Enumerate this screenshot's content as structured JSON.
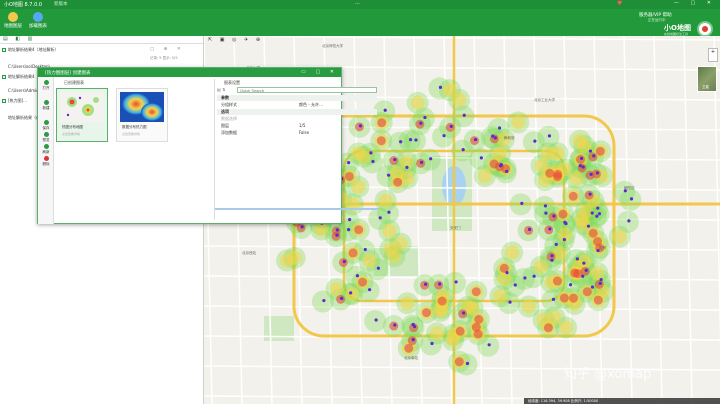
{
  "window": {
    "title": "小O地图 8.7.0.0",
    "badge": "新版本",
    "more": "...",
    "controls": "— ▢ ✕"
  },
  "ribbon": {
    "buttons": [
      {
        "label": "地图图层",
        "icon": "map-layers-icon",
        "color": "#f2c94c"
      },
      {
        "label": "加载图表",
        "icon": "chart-load-icon",
        "color": "#56a8f5"
      }
    ],
    "user": "服务器/VIP  帮助",
    "user_sub": "正在运行中",
    "help": "",
    "brand": "小O地图",
    "brand_sub": "在线地图标注工具"
  },
  "left_panel": {
    "toolbar": "▤ ◧ ▥",
    "layers": [
      {
        "label": "地址解析结果4（地址解析）",
        "sub": "",
        "tools": "▢ ⊕ ✕"
      },
      {
        "label": "C:\\Users\\xo\\Desktop\\",
        "sub": "记录: 5 显示: 5/5",
        "tools": ""
      },
      {
        "label": "地址解析结果4（地址解析）",
        "sub": "",
        "tools": ""
      },
      {
        "label": "C:\\Users\\Admin\\Desktop\\",
        "sub": "",
        "tools": ""
      },
      {
        "label": "[热力图]...",
        "sub": "",
        "tools": ""
      },
      {
        "label": "地址解析结果（在线地图...）",
        "sub": "",
        "tools": ""
      }
    ]
  },
  "dialog": {
    "title": "[热力图图层] 创建图表",
    "controls": "▭ ▢ ✕",
    "side_buttons": [
      {
        "label": "打开",
        "color": "#2e9a45"
      },
      {
        "label": "新建",
        "color": "#2e9a45"
      },
      {
        "label": "保存",
        "color": "#2e9a45"
      },
      {
        "label": "预览",
        "color": "#2e9a45"
      },
      {
        "label": "刷新",
        "color": "#2e9a45"
      },
      {
        "label": "删除",
        "color": "#d33"
      }
    ],
    "templates_label": "已创建图表",
    "templates": [
      {
        "label": "热图分布地图",
        "sub": "点击查看详情",
        "selected": true
      },
      {
        "label": "数据分布热力图",
        "sub": "点击查看详情",
        "selected": false
      }
    ],
    "props": {
      "title": "图表设置",
      "toolbar": "▤ ⇅",
      "search_placeholder": "Quick Search",
      "rows": [
        {
          "key": "参数",
          "value": "",
          "category": true
        },
        {
          "key": "分组样式",
          "value": "颜色 - 允许…",
          "category": false
        },
        {
          "key": "选项",
          "value": "",
          "category": true
        },
        {
          "key": "数据选择",
          "value": "",
          "category": false,
          "muted": true
        },
        {
          "key": "图层",
          "value": "1/5",
          "category": false
        },
        {
          "key": "添加数据",
          "value": "False",
          "category": false
        }
      ]
    }
  },
  "map": {
    "toolbar": "⇱ ▣ ◎ ✈ ⊕",
    "zoom": "+",
    "satellite_label": "卫星",
    "watermark": "知乎 @xomap",
    "status": "经纬度: 116.394, 39.908  比例尺: 1:50000",
    "labels": [
      "北京师范大学",
      "北京大学",
      "北京工业大学",
      "天安门",
      "朝阳区",
      "中关村",
      "雍和宫",
      "国贸",
      "北京西站",
      "北京南站"
    ],
    "colors": {
      "road_major": "#f2c84b",
      "road_minor": "#ffffff",
      "park": "#cfe8c2",
      "water": "#a8d3f0",
      "heat_low": "#7ed957",
      "heat_mid": "#f5d547",
      "heat_high": "#e8483b",
      "point": "#5a2ccf"
    }
  },
  "theme": {
    "primary": "#229a3b",
    "titlebar": "#1e8f36"
  }
}
